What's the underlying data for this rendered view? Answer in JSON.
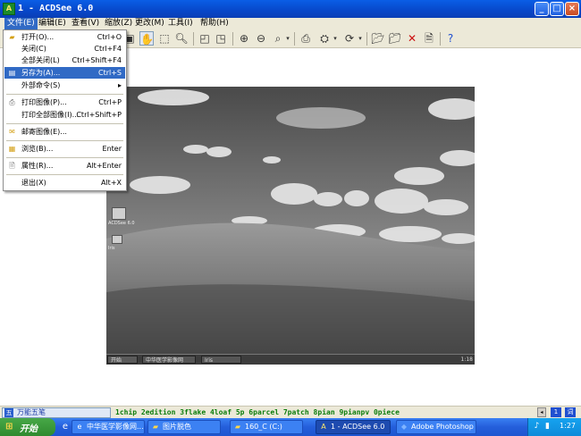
{
  "window": {
    "title": "1 - ACDSee 6.0",
    "controls": {
      "minimize": "_",
      "maximize": "□",
      "close": "×"
    }
  },
  "menubar": {
    "items": [
      {
        "label": "文件(E)"
      },
      {
        "label": "编辑(E)"
      },
      {
        "label": "查看(V)"
      },
      {
        "label": "缩放(Z)"
      },
      {
        "label": "更改(M)"
      },
      {
        "label": "工具(I)"
      },
      {
        "label": "帮助(H)"
      }
    ]
  },
  "toolbar": {
    "icons": [
      "hand-tool-icon",
      "select-tool-icon",
      "zoom-tool-icon",
      "fit-image-icon",
      "full-screen-icon",
      "zoom-in-icon",
      "zoom-out-icon",
      "zoom-menu-icon",
      "print-icon",
      "acquire-icon",
      "rotate-icon",
      "move-to-icon",
      "copy-to-icon",
      "delete-icon",
      "properties-icon",
      "help-icon"
    ]
  },
  "file_menu": {
    "items": [
      {
        "label": "打开(O)...",
        "shortcut": "Ctrl+O",
        "icon": "open-folder-icon"
      },
      {
        "label": "关闭(C)",
        "shortcut": "Ctrl+F4"
      },
      {
        "label": "全部关闭(L)",
        "shortcut": "Ctrl+Shift+F4"
      },
      {
        "label": "另存为(A)...",
        "shortcut": "Ctrl+S",
        "icon": "save-icon",
        "highlighted": true
      },
      {
        "label": "外部命令(S)",
        "shortcut": "▸"
      },
      {
        "label": "打印图像(P)...",
        "shortcut": "Ctrl+P",
        "icon": "print-icon"
      },
      {
        "label": "打印全部图像(I)...",
        "shortcut": "Ctrl+Shift+P"
      },
      {
        "label": "邮寄图像(E)...",
        "shortcut": "",
        "icon": "mail-icon"
      },
      {
        "label": "浏览(B)...",
        "shortcut": "Enter",
        "icon": "browse-icon"
      },
      {
        "label": "属性(R)...",
        "shortcut": "Alt+Enter",
        "icon": "properties-icon"
      },
      {
        "label": "退出(X)",
        "shortcut": "Alt+X"
      }
    ]
  },
  "photo": {
    "desktop_icon_labels": [
      "ACDSee 6.0",
      "Iris"
    ],
    "taskbar": {
      "start": "开始",
      "items": [
        "中华医学影像网",
        "Iris"
      ],
      "tray_time": "1:18"
    }
  },
  "ime_bar": {
    "ime_name": "万能五笔",
    "candidates": "1chip 2edition 3flake 4loaf 5p 6parcel 7patch 8pian 9pianpv 0piece",
    "right_buttons": [
      "1",
      "词"
    ]
  },
  "taskbar": {
    "start_label": "开始",
    "tasks": [
      {
        "label": "中华医学影像网...",
        "icon": "ie-icon"
      },
      {
        "label": "图片脱色",
        "icon": "folder-icon"
      },
      {
        "label": "160_C (C:)",
        "icon": "folder-icon"
      },
      {
        "label": "1 - ACDSee 6.0",
        "icon": "acdsee-icon",
        "active": true
      },
      {
        "label": "Adobe Photoshop",
        "icon": "photoshop-icon"
      }
    ],
    "clock": "1:27"
  },
  "colors": {
    "title_bar": "#0747c9",
    "menu_highlight": "#316ac5",
    "taskbar": "#245edb",
    "start_button": "#2f8a2f",
    "ime_candidates": "#0c7d0c"
  }
}
